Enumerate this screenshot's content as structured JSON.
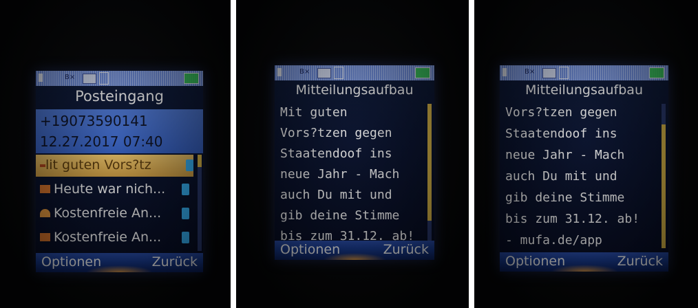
{
  "panel1": {
    "title": "Posteingang",
    "sender": "+19073590141",
    "datetime": "12.27.2017 07:40",
    "selected_item": "lit guten Vors?tz",
    "items": [
      "Heute war nich...",
      "Kostenfreie An...",
      "Kostenfreie An..."
    ],
    "softkey_left": "Optionen",
    "softkey_right": "Zurück"
  },
  "panel2": {
    "title": "Mitteilungsaufbau",
    "lines": [
      "Mit guten",
      "Vors?tzen gegen",
      "Staatendoof ins",
      "neue Jahr - Mach",
      "auch Du mit und",
      "gib deine Stimme",
      "bis zum 31.12. ab!"
    ],
    "softkey_left": "Optionen",
    "softkey_right": "Zurück"
  },
  "panel3": {
    "title": "Mitteilungsaufbau",
    "lines": [
      "Vors?tzen gegen",
      "Staatendoof ins",
      "neue Jahr - Mach",
      "auch Du mit und",
      "gib deine Stimme",
      "bis zum 31.12. ab!",
      "- mufa.de/app"
    ],
    "softkey_left": "Optionen",
    "softkey_right": "Zurück"
  },
  "colors": {
    "highlight": "#3561c6",
    "selection": "#e0ad4f",
    "status_bar": "#8aa6ee",
    "battery": "#2fd24a",
    "text": "#ffffff"
  },
  "icons": [
    "sim-icon",
    "bx-icon",
    "message-icon",
    "network-icon",
    "battery-icon",
    "envelope-icon",
    "phone-icon"
  ]
}
